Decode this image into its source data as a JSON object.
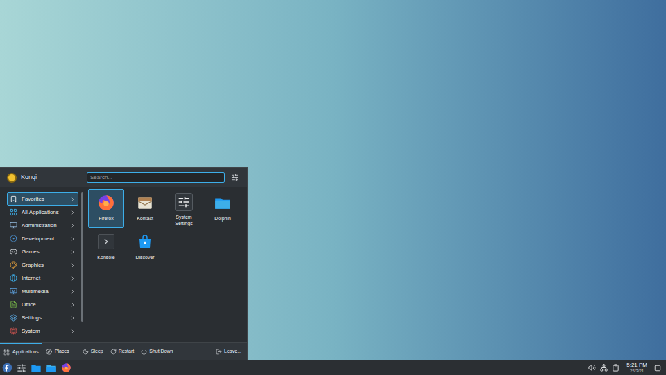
{
  "menu": {
    "user": "Konqi",
    "search": {
      "placeholder": "Search..."
    }
  },
  "categories": [
    {
      "label": "Favorites",
      "selected": true
    },
    {
      "label": "All Applications",
      "selected": false
    },
    {
      "label": "Administration",
      "selected": false
    },
    {
      "label": "Development",
      "selected": false
    },
    {
      "label": "Games",
      "selected": false
    },
    {
      "label": "Graphics",
      "selected": false
    },
    {
      "label": "Internet",
      "selected": false
    },
    {
      "label": "Multimedia",
      "selected": false
    },
    {
      "label": "Office",
      "selected": false
    },
    {
      "label": "Settings",
      "selected": false
    },
    {
      "label": "System",
      "selected": false
    }
  ],
  "apps": [
    {
      "label": "Firefox",
      "selected": true
    },
    {
      "label": "Kontact",
      "selected": false
    },
    {
      "label": "System Settings",
      "selected": false
    },
    {
      "label": "Dolphin",
      "selected": false
    },
    {
      "label": "Konsole",
      "selected": false
    },
    {
      "label": "Discover",
      "selected": false
    }
  ],
  "footer": {
    "tabs": [
      {
        "label": "Applications",
        "selected": true
      },
      {
        "label": "Places",
        "selected": false
      }
    ],
    "actions": [
      "Sleep",
      "Restart",
      "Shut Down"
    ],
    "leave": "Leave..."
  },
  "taskbar": {
    "clock": {
      "time": "5:21 PM",
      "date": "25/3/21"
    }
  }
}
